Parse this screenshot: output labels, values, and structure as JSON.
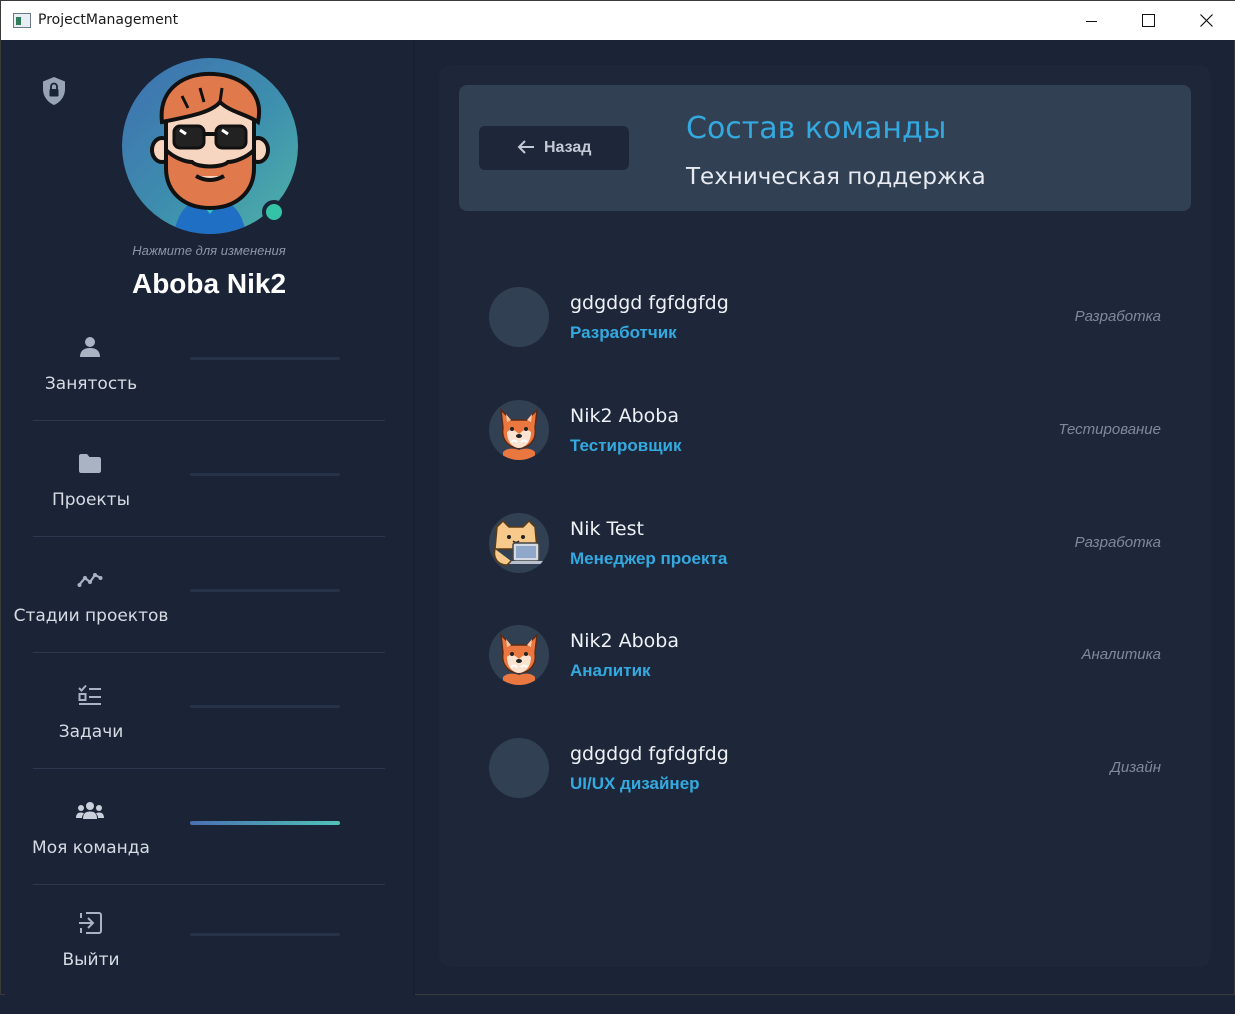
{
  "window": {
    "title": "ProjectManagement"
  },
  "profile": {
    "change_hint": "Нажмите для изменения",
    "name": "Aboba Nik2"
  },
  "nav": [
    {
      "label": "Занятость",
      "icon": "person-icon",
      "active": false
    },
    {
      "label": "Проекты",
      "icon": "folder-icon",
      "active": false
    },
    {
      "label": "Стадии проектов",
      "icon": "trend-line-icon",
      "active": false
    },
    {
      "label": "Задачи",
      "icon": "checklist-icon",
      "active": false
    },
    {
      "label": "Моя команда",
      "icon": "team-icon",
      "active": true
    },
    {
      "label": "Выйти",
      "icon": "logout-icon",
      "active": false
    }
  ],
  "header": {
    "back_label": "Назад",
    "title": "Состав команды",
    "subtitle": "Техническая поддержка"
  },
  "members": [
    {
      "name": "gdgdgd fgfdgfdg",
      "role": "Разработчик",
      "department": "Разработка",
      "avatar": "empty"
    },
    {
      "name": "Nik2 Aboba",
      "role": "Тестировщик",
      "department": "Тестирование",
      "avatar": "fox"
    },
    {
      "name": "Nik Test",
      "role": "Менеджер проекта",
      "department": "Разработка",
      "avatar": "cat-laptop"
    },
    {
      "name": "Nik2 Aboba",
      "role": "Аналитик",
      "department": "Аналитика",
      "avatar": "fox"
    },
    {
      "name": "gdgdgd fgfdgfdg",
      "role": "UI/UX дизайнер",
      "department": "Дизайн",
      "avatar": "empty"
    }
  ],
  "colors": {
    "background": "#1b2436",
    "card": "#324054",
    "accent": "#34a9e0",
    "status": "#34c3a6"
  }
}
